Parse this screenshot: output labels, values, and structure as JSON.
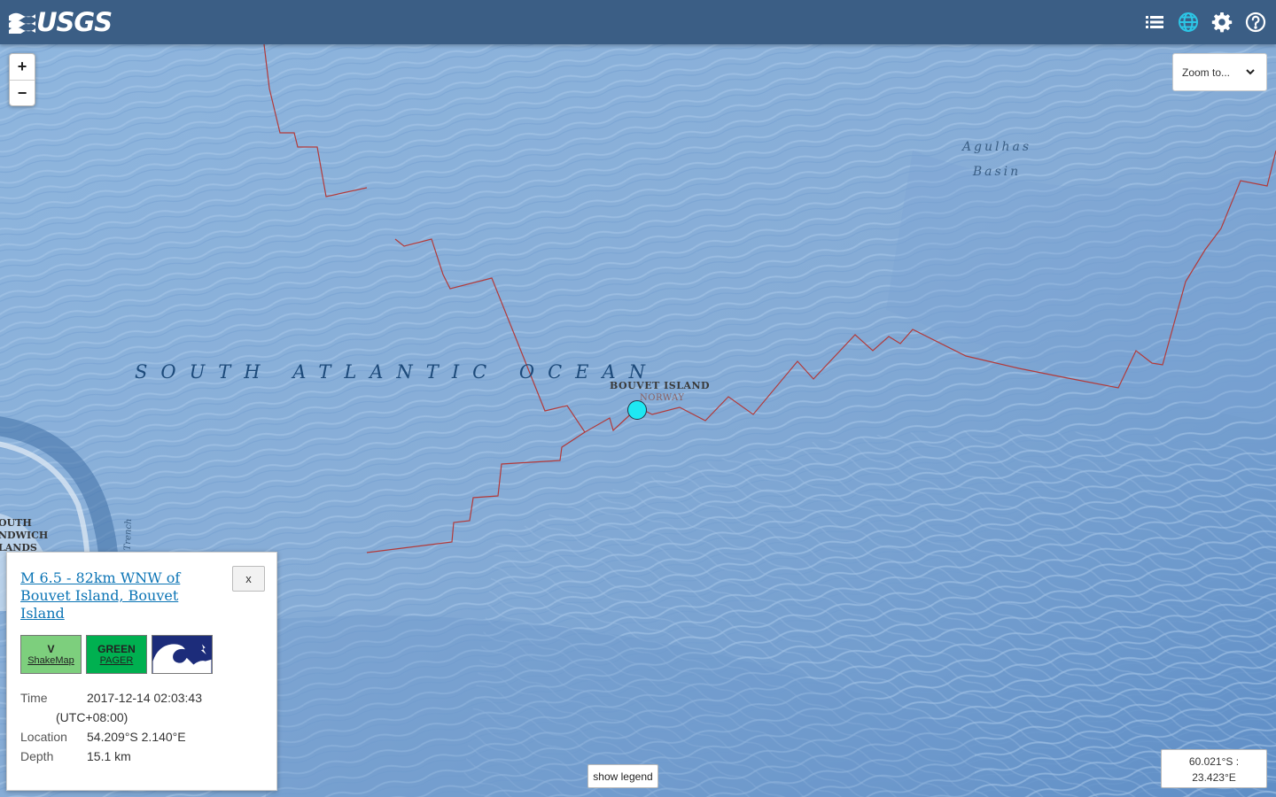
{
  "header": {
    "logo_text": "USGS",
    "icons": [
      "list-icon",
      "globe-icon",
      "gear-icon",
      "help-icon"
    ],
    "brand_color": "#3b5e85",
    "active_icon_color": "#2cc6e6"
  },
  "map_controls": {
    "zoom_in": "+",
    "zoom_out": "−",
    "zoom_to_label": "Zoom to...",
    "show_legend_label": "show legend",
    "coords_line1": "60.021°S :",
    "coords_line2": "23.423°E"
  },
  "map_labels": {
    "ocean": "SOUTH ATLANTIC OCEAN",
    "basin_line1": "Agulhas",
    "basin_line2": "Basin",
    "island": "BOUVET ISLAND",
    "country": "NORWAY",
    "sandwich_line1": "OUTH",
    "sandwich_line2": "NDWICH",
    "sandwich_line3": "LANDS",
    "trench": "Trench"
  },
  "event": {
    "title": "M 6.5 - 82km WNW of Bouvet Island, Bouvet Island",
    "close_label": "x",
    "shakemap_value": "V",
    "shakemap_label": "ShakeMap",
    "pager_value": "GREEN",
    "pager_label": "PAGER",
    "time_label": "Time",
    "time_value": "2017-12-14 02:03:43",
    "time_zone": "(UTC+08:00)",
    "location_label": "Location",
    "location_value": "54.209°S 2.140°E",
    "depth_label": "Depth",
    "depth_value": "15.1 km",
    "epicenter_color": "#1ee8f3"
  }
}
